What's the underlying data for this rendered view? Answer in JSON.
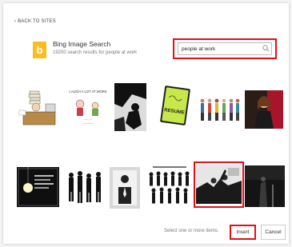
{
  "nav": {
    "back_label": "‹ BACK TO SITES"
  },
  "provider": {
    "logo_letter": "b",
    "title": "Bing Image Search",
    "result_summary": "19200 search results for people at work"
  },
  "search": {
    "value": "people at work",
    "placeholder": ""
  },
  "thumbnails_row1": [
    {
      "id": "r1-cartoon-desk",
      "selected": false
    },
    {
      "id": "r1-comic-sign",
      "text": "LAUGH A LOT AT WORK",
      "selected": false
    },
    {
      "id": "r1-silhouette-bw",
      "selected": false
    },
    {
      "id": "r1-green-resume",
      "text": "RESUME",
      "selected": false
    },
    {
      "id": "r1-people-row",
      "selected": false
    },
    {
      "id": "r1-woman-red",
      "selected": false
    }
  ],
  "thumbnails_row2": [
    {
      "id": "r2-dark-bulb",
      "selected": false
    },
    {
      "id": "r2-silhouettes",
      "selected": false
    },
    {
      "id": "r2-man-icon",
      "selected": false
    },
    {
      "id": "r2-crowd-silhouettes",
      "selected": false
    },
    {
      "id": "r2-office-photo",
      "selected": true
    },
    {
      "id": "r2-dark-stage",
      "selected": false
    }
  ],
  "footer": {
    "hint": "Select one or more items.",
    "insert_label": "Insert",
    "cancel_label": "Cancel"
  },
  "colors": {
    "highlight": "#e0101a",
    "bing": "#fbbc1f"
  }
}
